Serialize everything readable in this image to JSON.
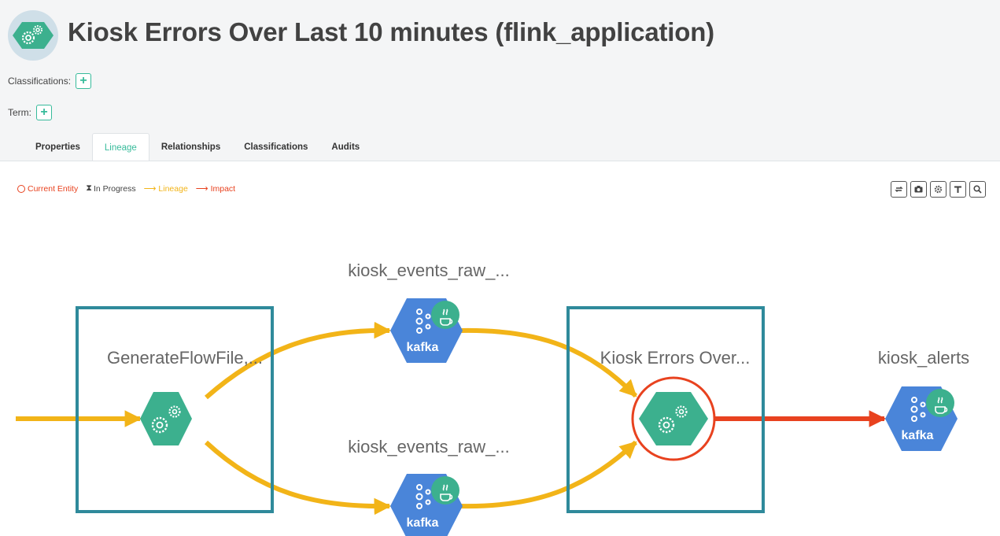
{
  "entity": {
    "title": "Kiosk Errors Over Last 10 minutes (flink_application)",
    "icon": "gears-icon"
  },
  "meta": {
    "classifications_label": "Classifications:",
    "term_label": "Term:",
    "add_icon": "plus-icon"
  },
  "tabs": [
    {
      "label": "Properties",
      "active": false
    },
    {
      "label": "Lineage",
      "active": true
    },
    {
      "label": "Relationships",
      "active": false
    },
    {
      "label": "Classifications",
      "active": false
    },
    {
      "label": "Audits",
      "active": false
    }
  ],
  "legend": {
    "current": "Current Entity",
    "in_progress": "In Progress",
    "lineage": "Lineage",
    "impact": "Impact"
  },
  "toolbar": {
    "buttons": [
      "refresh-icon",
      "camera-icon",
      "settings-icon",
      "filter-icon",
      "search-icon"
    ]
  },
  "colors": {
    "lineage": "#f2b418",
    "impact": "#e8421f",
    "process_node": "#3cb08e",
    "kafka_node": "#4a85d9",
    "process_box": "#2f8a9b"
  },
  "lineage_graph": {
    "nodes": [
      {
        "label": "GenerateFlowFile,...",
        "type": "process"
      },
      {
        "label": "kiosk_events_raw_...",
        "type": "kafka_topic",
        "icon_text": "kafka"
      },
      {
        "label": "kiosk_events_raw_...",
        "type": "kafka_topic",
        "icon_text": "kafka"
      },
      {
        "label": "Kiosk Errors Over...",
        "type": "process",
        "current": true
      },
      {
        "label": "kiosk_alerts",
        "type": "kafka_topic",
        "icon_text": "kafka"
      }
    ]
  }
}
